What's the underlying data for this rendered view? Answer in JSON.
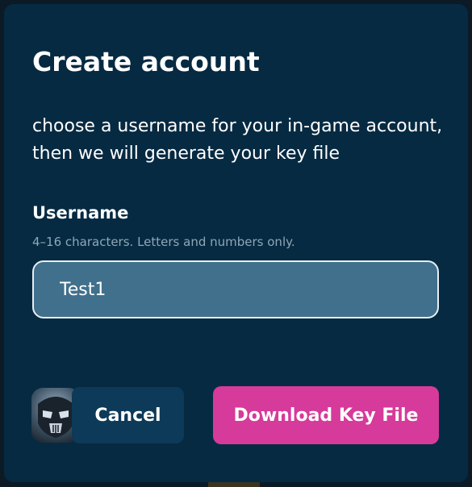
{
  "dialog": {
    "title": "Create account",
    "description": "choose a username for your in-game account, then we will generate your key file",
    "username_field": {
      "label": "Username",
      "hint": "4–16 characters. Letters and numbers only.",
      "value": "Test1",
      "placeholder": ""
    },
    "buttons": {
      "cancel_label": "Cancel",
      "download_label": "Download Key File"
    },
    "colors": {
      "dialog_background": "#062a42",
      "input_background": "#41708d",
      "cancel_background": "#0c3a58",
      "download_accent": "#d63a9a"
    }
  }
}
